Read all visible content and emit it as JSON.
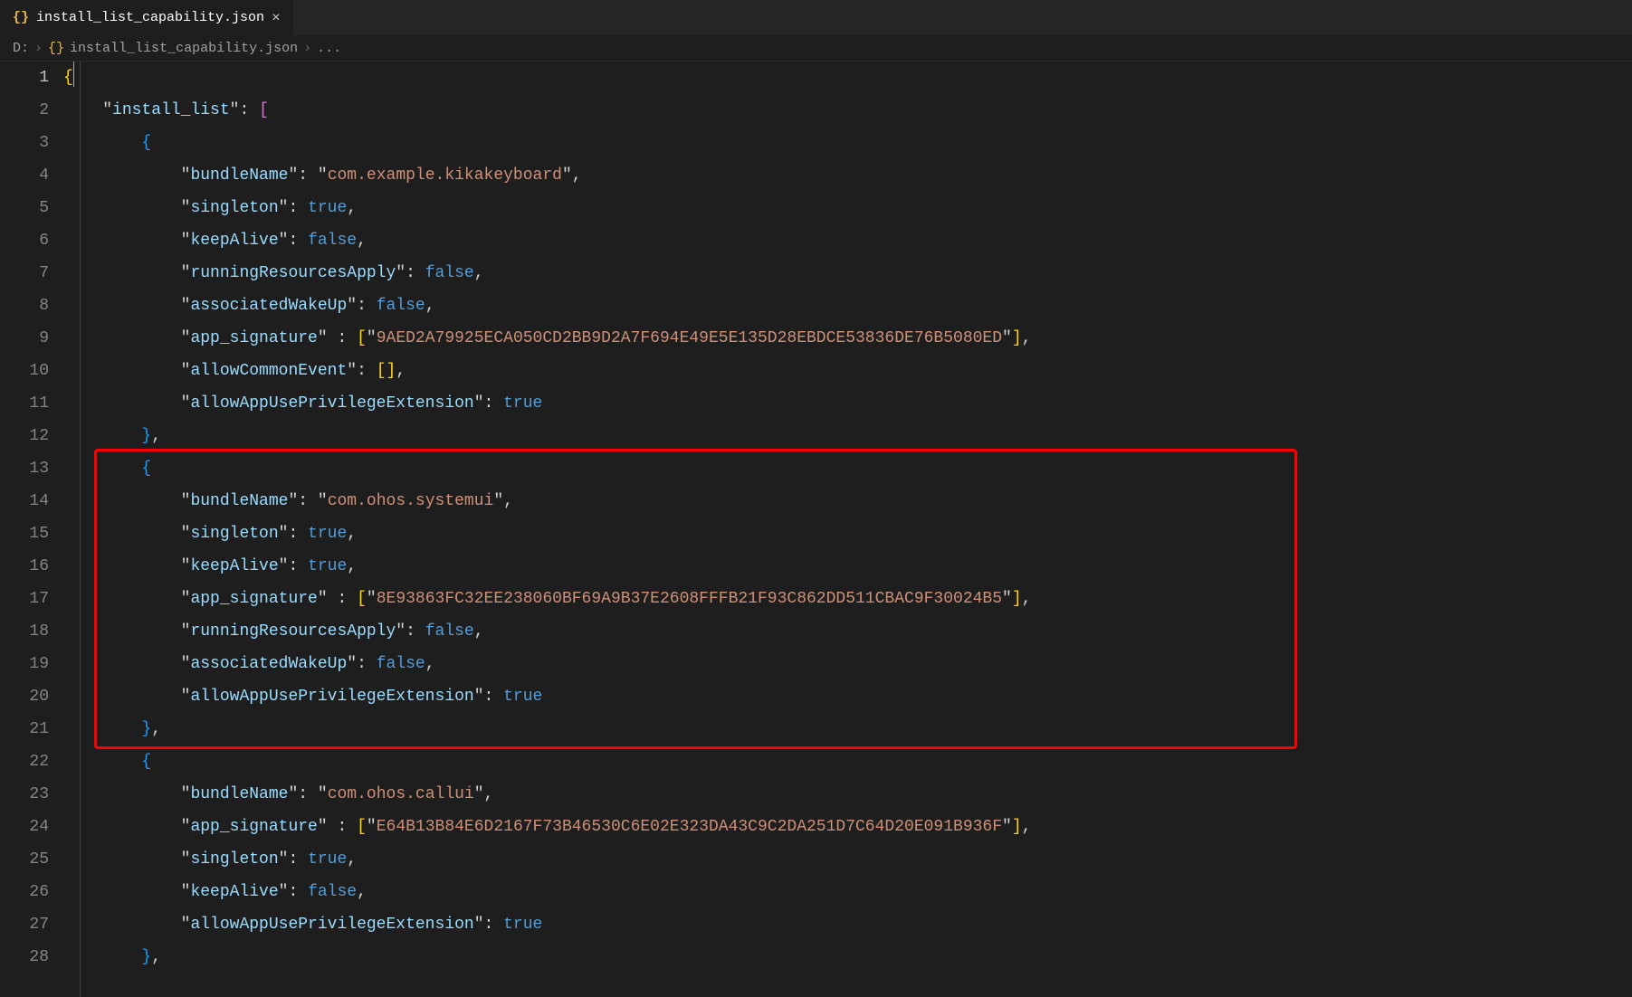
{
  "tab": {
    "icon": "{}",
    "filename": "install_list_capability.json",
    "close": "×"
  },
  "breadcrumb": {
    "drive": "D:",
    "sep": "›",
    "icon": "{}",
    "filename": "install_list_capability.json",
    "tail": "..."
  },
  "highlight": {
    "startLine": 13,
    "endLine": 21
  },
  "code": {
    "key_install_list": "install_list",
    "entries": [
      {
        "bundleName": "com.example.kikakeyboard",
        "singleton": true,
        "keepAlive": false,
        "runningResourcesApply": false,
        "associatedWakeUp": false,
        "app_signature": [
          "9AED2A79925ECA050CD2BB9D2A7F694E49E5E135D28EBDCE53836DE76B5080ED"
        ],
        "allowCommonEvent": [],
        "allowAppUsePrivilegeExtension": true
      },
      {
        "bundleName": "com.ohos.systemui",
        "singleton": true,
        "keepAlive": true,
        "app_signature": [
          "8E93863FC32EE238060BF69A9B37E2608FFFB21F93C862DD511CBAC9F30024B5"
        ],
        "runningResourcesApply": false,
        "associatedWakeUp": false,
        "allowAppUsePrivilegeExtension": true
      },
      {
        "bundleName": "com.ohos.callui",
        "app_signature": [
          "E64B13B84E6D2167F73B46530C6E02E323DA43C9C2DA251D7C64D20E091B936F"
        ],
        "singleton": true,
        "keepAlive": false,
        "allowAppUsePrivilegeExtension": true
      }
    ]
  },
  "lineCount": 28
}
